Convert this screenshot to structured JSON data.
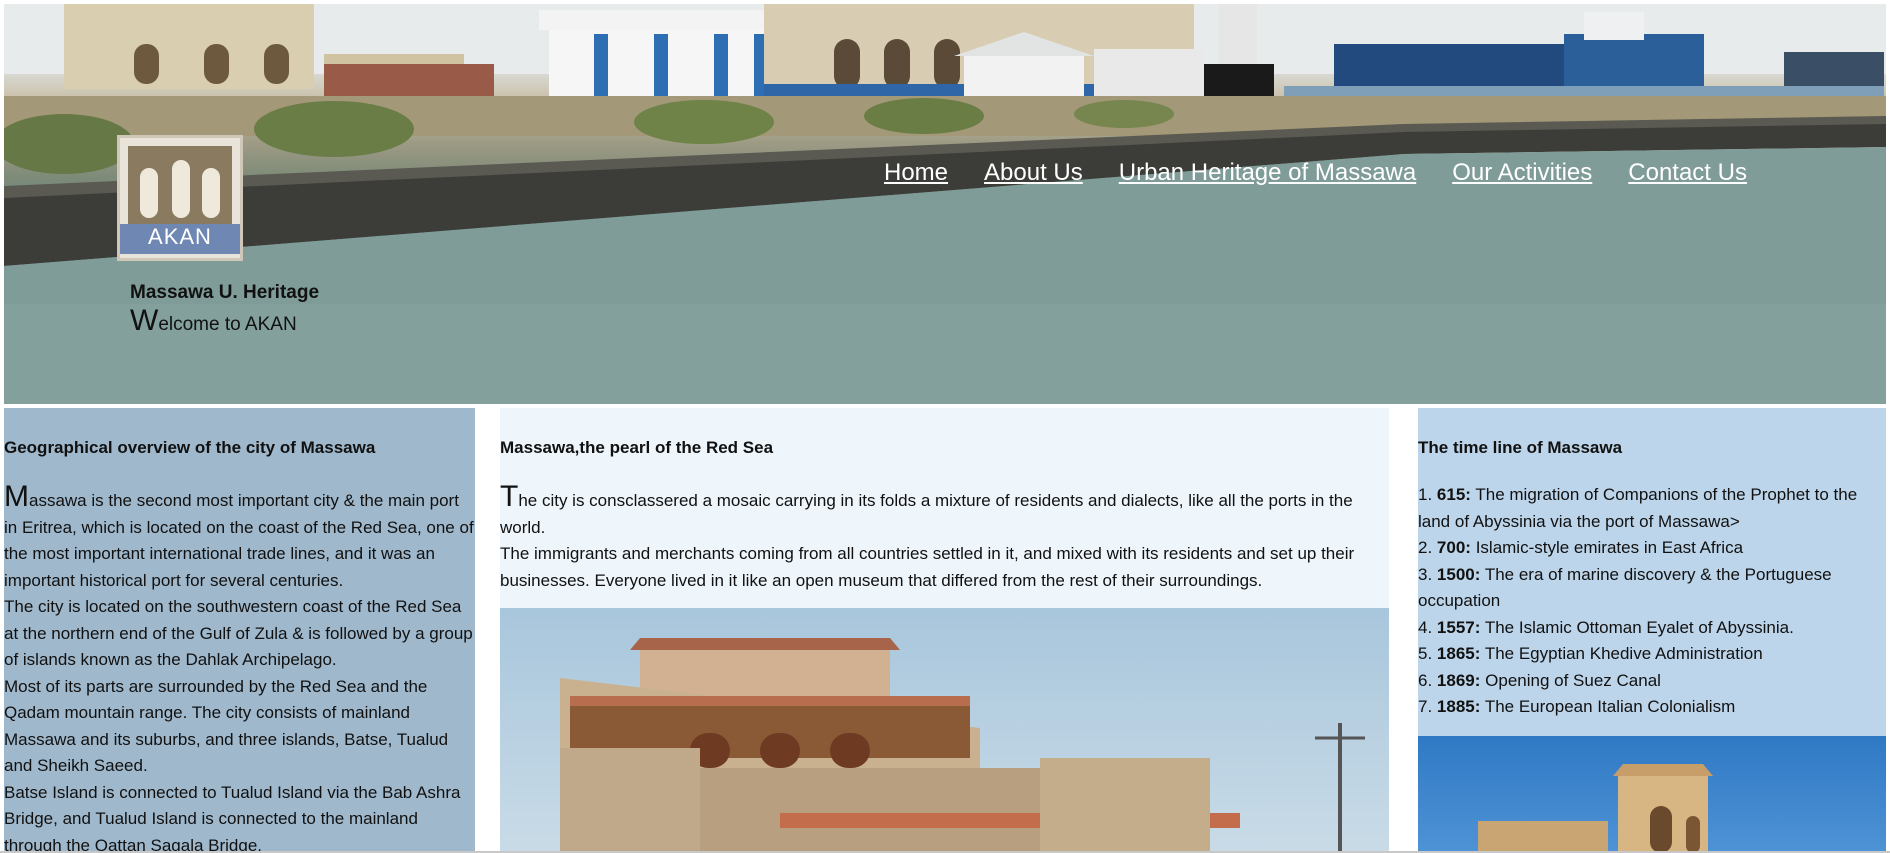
{
  "header": {
    "logo_text": "AKAN",
    "site_name": "Massawa U. Heritage",
    "tagline_first_letter": "W",
    "tagline_rest": "elcome to AKAN"
  },
  "nav": {
    "items": [
      "Home",
      "About Us",
      "Urban Heritage of Massawa",
      "Our Activities",
      "Contact Us"
    ]
  },
  "left": {
    "heading": "Geographical overview of the city of Massawa",
    "first_letter": "M",
    "first_para_rest": "assawa is the second most important city & the main port in Eritrea, which is located on the coast of the Red Sea, one of the most important international trade lines, and it was an important historical port for several centuries.",
    "paragraphs": [
      "The city is located on the southwestern coast of the Red Sea at the northern end of the Gulf of Zula & is followed by a group of islands known as the Dahlak Archipelago.",
      "Most of its parts are surrounded by the Red Sea and the Qadam mountain range. The city consists of mainland Massawa and its suburbs, and three islands, Batse, Tualud and Sheikh Saeed.",
      "Batse Island is connected to Tualud Island via the Bab Ashra Bridge, and Tualud Island is connected to the mainland through the Qattan Sagala Bridge."
    ]
  },
  "middle": {
    "heading": "Massawa,the pearl of the Red Sea",
    "first_letter": "T",
    "first_para_rest": "he city is consclassered a mosaic carrying in its folds a mixture of residents and dialects, like all the ports in the world.",
    "second_para": "The immigrants and merchants coming from all countries settled in it, and mixed with its residents and set up their businesses. Everyone lived in it like an open museum that differed from the rest of their surroundings."
  },
  "right": {
    "heading": "The time line of Massawa",
    "timeline": [
      {
        "num": "1.",
        "year": "615:",
        "text": "The migration of Companions of the Prophet to the land of Abyssinia via the port of Massawa>"
      },
      {
        "num": "2.",
        "year": "700:",
        "text": "Islamic-style emirates in East Africa"
      },
      {
        "num": "3.",
        "year": "1500:",
        "text": "The era of marine discovery & the Portuguese occupation"
      },
      {
        "num": "4.",
        "year": "1557:",
        "text": "The Islamic Ottoman Eyalet of Abyssinia."
      },
      {
        "num": "5.",
        "year": "1865:",
        "text": "The Egyptian Khedive Administration"
      },
      {
        "num": "6.",
        "year": "1869:",
        "text": "Opening of Suez Canal"
      },
      {
        "num": "7.",
        "year": "1885:",
        "text": "The European Italian Colonialism"
      }
    ]
  },
  "colors": {
    "left_bg": "#9fb8cc",
    "middle_bg": "#eef5fb",
    "right_bg": "#bdd5ea",
    "nav_text": "#ffffff"
  }
}
